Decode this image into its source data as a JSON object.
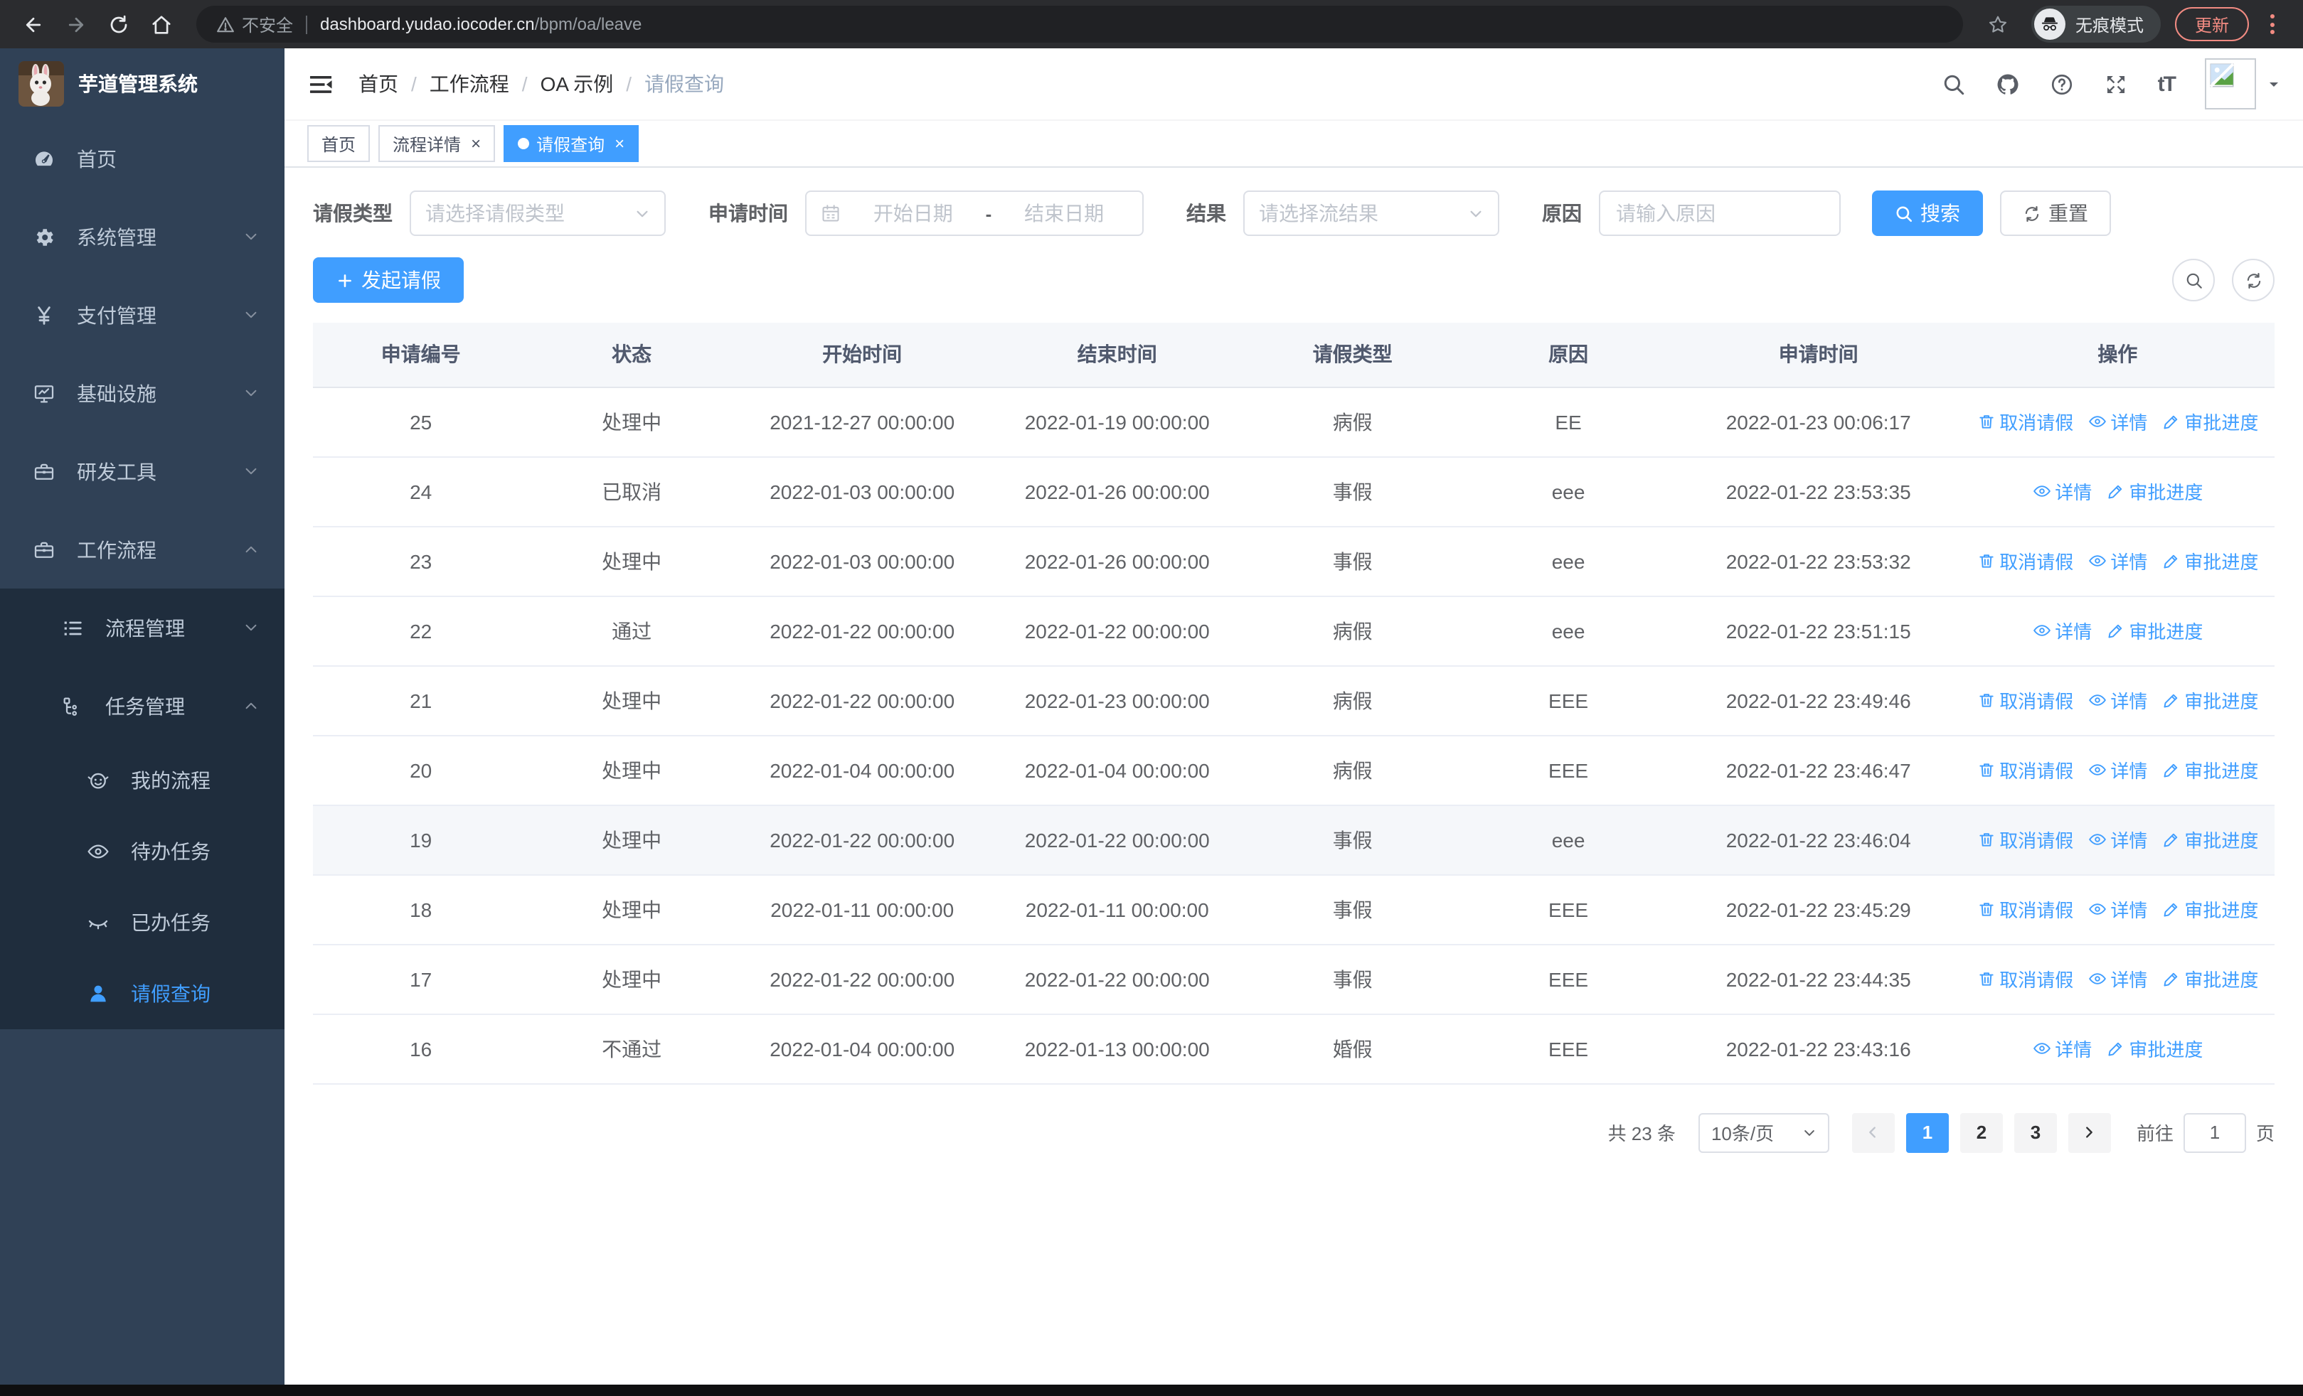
{
  "browser": {
    "security_label": "不安全",
    "url_host": "dashboard.yudao.iocoder.cn",
    "url_path": "/bpm/oa/leave",
    "incognito_label": "无痕模式",
    "update_label": "更新"
  },
  "sidebar": {
    "app_title": "芋道管理系统",
    "items": [
      {
        "label": "首页",
        "icon": "dashboard-icon",
        "level": 1,
        "chevron": "none",
        "active": false
      },
      {
        "label": "系统管理",
        "icon": "gear-icon",
        "level": 1,
        "chevron": "down",
        "active": false
      },
      {
        "label": "支付管理",
        "icon": "yen-icon",
        "level": 1,
        "chevron": "down",
        "active": false
      },
      {
        "label": "基础设施",
        "icon": "monitor-icon",
        "level": 1,
        "chevron": "down",
        "active": false
      },
      {
        "label": "研发工具",
        "icon": "toolbox-icon",
        "level": 1,
        "chevron": "down",
        "active": false
      },
      {
        "label": "工作流程",
        "icon": "briefcase-icon",
        "level": 1,
        "chevron": "up",
        "active": false
      },
      {
        "label": "流程管理",
        "icon": "list-icon",
        "level": 2,
        "chevron": "down",
        "active": false
      },
      {
        "label": "任务管理",
        "icon": "tree-icon",
        "level": 2,
        "chevron": "up",
        "active": false
      },
      {
        "label": "我的流程",
        "icon": "face-icon",
        "level": 3,
        "chevron": "none",
        "active": false
      },
      {
        "label": "待办任务",
        "icon": "eye-open-icon",
        "level": 3,
        "chevron": "none",
        "active": false
      },
      {
        "label": "已办任务",
        "icon": "eye-closed-icon",
        "level": 3,
        "chevron": "none",
        "active": false
      },
      {
        "label": "请假查询",
        "icon": "user-icon",
        "level": 3,
        "chevron": "none",
        "active": true
      }
    ]
  },
  "header": {
    "breadcrumb": [
      "首页",
      "工作流程",
      "OA 示例",
      "请假查询"
    ],
    "font_size_icon_text": "tT"
  },
  "tabs": [
    {
      "label": "首页",
      "closable": false,
      "active": false
    },
    {
      "label": "流程详情",
      "closable": true,
      "active": false
    },
    {
      "label": "请假查询",
      "closable": true,
      "active": true
    }
  ],
  "filters": {
    "leave_type_label": "请假类型",
    "leave_type_placeholder": "请选择请假类型",
    "apply_time_label": "申请时间",
    "start_date_placeholder": "开始日期",
    "range_separator": "-",
    "end_date_placeholder": "结束日期",
    "result_label": "结果",
    "result_placeholder": "请选择流结果",
    "reason_label": "原因",
    "reason_placeholder": "请输入原因",
    "search_label": "搜索",
    "reset_label": "重置"
  },
  "toolbar": {
    "create_label": "发起请假"
  },
  "table": {
    "columns": [
      "申请编号",
      "状态",
      "开始时间",
      "结束时间",
      "请假类型",
      "原因",
      "申请时间",
      "操作"
    ],
    "action_labels": {
      "cancel": "取消请假",
      "detail": "详情",
      "progress": "审批进度"
    },
    "rows": [
      {
        "id": "25",
        "status": "处理中",
        "start": "2021-12-27 00:00:00",
        "end": "2022-01-19 00:00:00",
        "type": "病假",
        "reason": "EE",
        "apply_time": "2022-01-23 00:06:17",
        "actions": [
          "cancel",
          "detail",
          "progress"
        ],
        "highlight": false
      },
      {
        "id": "24",
        "status": "已取消",
        "start": "2022-01-03 00:00:00",
        "end": "2022-01-26 00:00:00",
        "type": "事假",
        "reason": "eee",
        "apply_time": "2022-01-22 23:53:35",
        "actions": [
          "detail",
          "progress"
        ],
        "highlight": false
      },
      {
        "id": "23",
        "status": "处理中",
        "start": "2022-01-03 00:00:00",
        "end": "2022-01-26 00:00:00",
        "type": "事假",
        "reason": "eee",
        "apply_time": "2022-01-22 23:53:32",
        "actions": [
          "cancel",
          "detail",
          "progress"
        ],
        "highlight": false
      },
      {
        "id": "22",
        "status": "通过",
        "start": "2022-01-22 00:00:00",
        "end": "2022-01-22 00:00:00",
        "type": "病假",
        "reason": "eee",
        "apply_time": "2022-01-22 23:51:15",
        "actions": [
          "detail",
          "progress"
        ],
        "highlight": false
      },
      {
        "id": "21",
        "status": "处理中",
        "start": "2022-01-22 00:00:00",
        "end": "2022-01-23 00:00:00",
        "type": "病假",
        "reason": "EEE",
        "apply_time": "2022-01-22 23:49:46",
        "actions": [
          "cancel",
          "detail",
          "progress"
        ],
        "highlight": false
      },
      {
        "id": "20",
        "status": "处理中",
        "start": "2022-01-04 00:00:00",
        "end": "2022-01-04 00:00:00",
        "type": "病假",
        "reason": "EEE",
        "apply_time": "2022-01-22 23:46:47",
        "actions": [
          "cancel",
          "detail",
          "progress"
        ],
        "highlight": false
      },
      {
        "id": "19",
        "status": "处理中",
        "start": "2022-01-22 00:00:00",
        "end": "2022-01-22 00:00:00",
        "type": "事假",
        "reason": "eee",
        "apply_time": "2022-01-22 23:46:04",
        "actions": [
          "cancel",
          "detail",
          "progress"
        ],
        "highlight": true
      },
      {
        "id": "18",
        "status": "处理中",
        "start": "2022-01-11 00:00:00",
        "end": "2022-01-11 00:00:00",
        "type": "事假",
        "reason": "EEE",
        "apply_time": "2022-01-22 23:45:29",
        "actions": [
          "cancel",
          "detail",
          "progress"
        ],
        "highlight": false
      },
      {
        "id": "17",
        "status": "处理中",
        "start": "2022-01-22 00:00:00",
        "end": "2022-01-22 00:00:00",
        "type": "事假",
        "reason": "EEE",
        "apply_time": "2022-01-22 23:44:35",
        "actions": [
          "cancel",
          "detail",
          "progress"
        ],
        "highlight": false
      },
      {
        "id": "16",
        "status": "不通过",
        "start": "2022-01-04 00:00:00",
        "end": "2022-01-13 00:00:00",
        "type": "婚假",
        "reason": "EEE",
        "apply_time": "2022-01-22 23:43:16",
        "actions": [
          "detail",
          "progress"
        ],
        "highlight": false
      }
    ]
  },
  "pagination": {
    "total_label": "共 23 条",
    "page_size": "10条/页",
    "pages": [
      "1",
      "2",
      "3"
    ],
    "active_page": "1",
    "goto_label": "前往",
    "goto_value": "1",
    "goto_suffix": "页"
  },
  "colors": {
    "accent": "#409eff",
    "sidebar_bg": "#304156",
    "submenu_bg": "#1f2d3d",
    "sidebar_text": "#bfcbd9",
    "update_button": "#f28b82",
    "table_header_bg": "#f5f7fa"
  }
}
